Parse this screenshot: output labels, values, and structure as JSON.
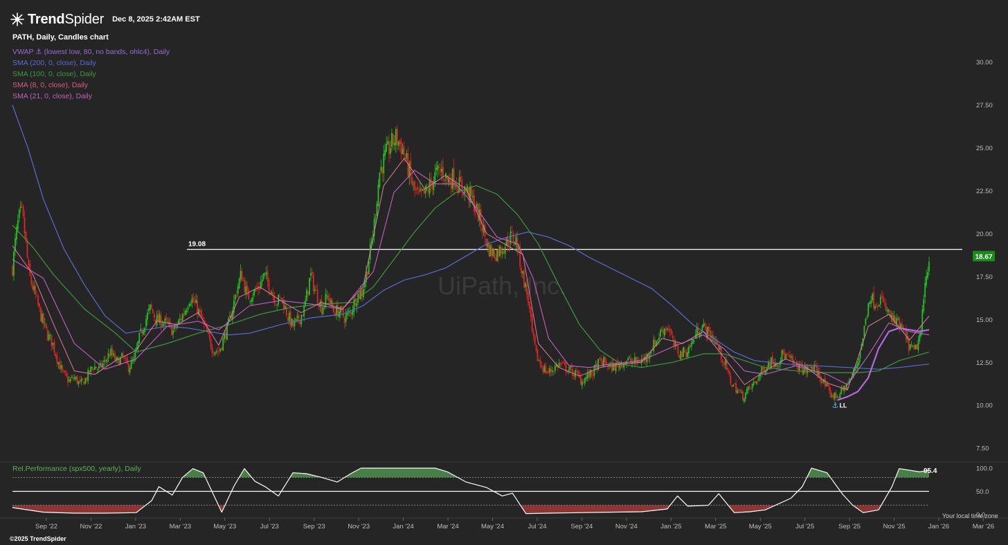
{
  "header": {
    "brand_bold": "Trend",
    "brand_thin": "Spider",
    "datetime": "Dec 8, 2025 2:42AM EST"
  },
  "symbol_line": "PATH, Daily, Candles chart",
  "indicators": [
    {
      "label": "VWAP ⚓ (lowest low, 80, no bands, ohlc4), Daily",
      "color": "#9b6bd4"
    },
    {
      "label": "SMA (200, 0, close), Daily",
      "color": "#5c6bd0"
    },
    {
      "label": "SMA (100, 0, close), Daily",
      "color": "#3d9a3d"
    },
    {
      "label": "SMA (8, 0, close), Daily",
      "color": "#e05a86"
    },
    {
      "label": "SMA (21, 0, close), Daily",
      "color": "#c75fc4"
    }
  ],
  "watermark": "UiPath, Inc.",
  "rel_perf": {
    "label": "Rel.Performance (spx500, yearly), Daily",
    "y_ticks": [
      "100.0",
      "50.0",
      "0.0"
    ],
    "last_value": "95.4"
  },
  "footer": {
    "copyright": "©2025 TrendSpider",
    "timezone": "Your local time zone"
  },
  "anchor_label": "LL",
  "chart_data": {
    "type": "candlestick",
    "symbol": "PATH",
    "interval": "Daily",
    "y_ticks": [
      7.5,
      10,
      12.5,
      15,
      17.5,
      20,
      22.5,
      25,
      27.5,
      30
    ],
    "y_tick_labels": [
      "7.50",
      "10.00",
      "12.50",
      "15.00",
      "17.50",
      "20.00",
      "22.50",
      "25.00",
      "27.50",
      "30.00"
    ],
    "ylim": [
      6.9,
      31.2
    ],
    "x_ticks": [
      "Sep '22",
      "Nov '22",
      "Jan '23",
      "Mar '23",
      "May '23",
      "Jul '23",
      "Sep '23",
      "Nov '23",
      "Jan '24",
      "Mar '24",
      "May '24",
      "Jul '24",
      "Sep '24",
      "Nov '24",
      "Jan '25",
      "Mar '25",
      "May '25",
      "Jul '25",
      "Sep '25",
      "Nov '25",
      "Jan '26",
      "Mar '26"
    ],
    "horizontal_line": {
      "value": 19.08,
      "label": "19.08"
    },
    "last_price": {
      "value": 18.67,
      "label": "18.67",
      "color": "#1a8c1a"
    },
    "price_path": [
      [
        0,
        18.0
      ],
      [
        0.3,
        19.7
      ],
      [
        0.6,
        20.9
      ],
      [
        0.9,
        21.3
      ],
      [
        1.2,
        20.0
      ],
      [
        1.6,
        17.6
      ],
      [
        2.2,
        16.4
      ],
      [
        2.8,
        15.1
      ],
      [
        3.4,
        14.1
      ],
      [
        3.9,
        13.6
      ],
      [
        4.4,
        12.6
      ],
      [
        4.9,
        11.8
      ],
      [
        5.5,
        11.4
      ],
      [
        6.0,
        11.6
      ],
      [
        6.6,
        11.2
      ],
      [
        7.2,
        11.6
      ],
      [
        7.8,
        12.3
      ],
      [
        8.4,
        12.1
      ],
      [
        8.9,
        12.5
      ],
      [
        9.5,
        13.1
      ],
      [
        10.1,
        12.5
      ],
      [
        10.7,
        12.8
      ],
      [
        11.2,
        12.2
      ],
      [
        11.8,
        12.6
      ],
      [
        12.3,
        13.9
      ],
      [
        12.8,
        14.8
      ],
      [
        13.4,
        15.7
      ],
      [
        13.9,
        15.0
      ],
      [
        14.5,
        14.9
      ],
      [
        15.0,
        14.7
      ],
      [
        15.6,
        14.3
      ],
      [
        16.1,
        14.8
      ],
      [
        16.7,
        15.5
      ],
      [
        17.2,
        16.3
      ],
      [
        17.8,
        15.8
      ],
      [
        18.3,
        15.1
      ],
      [
        18.9,
        14.1
      ],
      [
        19.4,
        13.3
      ],
      [
        20.0,
        13.1
      ],
      [
        20.5,
        13.9
      ],
      [
        21.1,
        15.0
      ],
      [
        21.7,
        16.6
      ],
      [
        22.2,
        17.7
      ],
      [
        22.8,
        16.3
      ],
      [
        23.3,
        16.5
      ],
      [
        23.9,
        16.9
      ],
      [
        24.4,
        17.6
      ],
      [
        25.0,
        16.9
      ],
      [
        25.6,
        16.0
      ],
      [
        26.1,
        16.3
      ],
      [
        26.7,
        15.2
      ],
      [
        27.2,
        14.6
      ],
      [
        27.8,
        15.0
      ],
      [
        28.3,
        15.6
      ],
      [
        28.9,
        17.6
      ],
      [
        29.4,
        16.6
      ],
      [
        30.0,
        15.7
      ],
      [
        30.6,
        16.4
      ],
      [
        31.1,
        15.5
      ],
      [
        31.7,
        15.5
      ],
      [
        32.2,
        15.1
      ],
      [
        32.8,
        15.4
      ],
      [
        33.3,
        16.3
      ],
      [
        33.9,
        16.6
      ],
      [
        34.4,
        17.9
      ],
      [
        35.0,
        20.1
      ],
      [
        35.6,
        23.6
      ],
      [
        36.1,
        24.4
      ],
      [
        36.7,
        25.2
      ],
      [
        37.2,
        25.6
      ],
      [
        37.8,
        25.0
      ],
      [
        38.3,
        24.0
      ],
      [
        38.9,
        22.6
      ],
      [
        39.4,
        22.1
      ],
      [
        40.0,
        22.3
      ],
      [
        40.6,
        22.9
      ],
      [
        41.1,
        23.5
      ],
      [
        41.7,
        23.7
      ],
      [
        42.2,
        23.1
      ],
      [
        42.8,
        23.3
      ],
      [
        43.3,
        22.8
      ],
      [
        43.9,
        22.6
      ],
      [
        44.4,
        22.2
      ],
      [
        45.0,
        21.4
      ],
      [
        45.6,
        20.4
      ],
      [
        46.1,
        19.2
      ],
      [
        46.7,
        18.8
      ],
      [
        47.2,
        19.0
      ],
      [
        47.8,
        19.4
      ],
      [
        48.3,
        19.8
      ],
      [
        48.9,
        19.6
      ],
      [
        49.4,
        17.8
      ],
      [
        50.0,
        16.2
      ],
      [
        50.4,
        14.2
      ],
      [
        50.8,
        12.9
      ],
      [
        51.3,
        12.3
      ],
      [
        51.9,
        11.9
      ],
      [
        52.4,
        12.1
      ],
      [
        53.0,
        12.4
      ],
      [
        53.6,
        12.2
      ],
      [
        54.1,
        12.0
      ],
      [
        54.7,
        11.8
      ],
      [
        55.2,
        11.4
      ],
      [
        55.8,
        11.7
      ],
      [
        56.3,
        11.9
      ],
      [
        56.9,
        12.5
      ],
      [
        57.5,
        12.5
      ],
      [
        58.0,
        12.2
      ],
      [
        58.6,
        12.3
      ],
      [
        59.1,
        12.5
      ],
      [
        59.7,
        12.6
      ],
      [
        60.2,
        12.5
      ],
      [
        60.8,
        12.6
      ],
      [
        61.4,
        12.7
      ],
      [
        61.9,
        13.3
      ],
      [
        62.5,
        13.8
      ],
      [
        63.0,
        14.4
      ],
      [
        63.6,
        14.6
      ],
      [
        64.1,
        13.5
      ],
      [
        64.7,
        13.0
      ],
      [
        65.3,
        13.1
      ],
      [
        65.8,
        13.5
      ],
      [
        66.4,
        14.3
      ],
      [
        66.9,
        14.6
      ],
      [
        67.5,
        14.2
      ],
      [
        68.1,
        13.9
      ],
      [
        68.6,
        13.1
      ],
      [
        69.2,
        12.2
      ],
      [
        69.7,
        11.3
      ],
      [
        70.3,
        10.9
      ],
      [
        70.8,
        10.5
      ],
      [
        71.4,
        10.9
      ],
      [
        72.0,
        11.3
      ],
      [
        72.5,
        11.8
      ],
      [
        73.1,
        12.3
      ],
      [
        73.6,
        12.6
      ],
      [
        74.2,
        12.5
      ],
      [
        74.7,
        13.0
      ],
      [
        75.3,
        12.7
      ],
      [
        75.9,
        12.4
      ],
      [
        76.4,
        12.2
      ],
      [
        77.0,
        12.0
      ],
      [
        77.5,
        12.3
      ],
      [
        78.1,
        11.9
      ],
      [
        78.6,
        11.4
      ],
      [
        79.2,
        10.7
      ],
      [
        79.8,
        10.5
      ],
      [
        80.3,
        10.7
      ],
      [
        80.9,
        11.2
      ],
      [
        81.4,
        11.6
      ],
      [
        82.0,
        12.6
      ],
      [
        82.5,
        14.0
      ],
      [
        83.1,
        16.4
      ],
      [
        83.6,
        16.0
      ],
      [
        84.2,
        16.2
      ],
      [
        84.7,
        15.6
      ],
      [
        85.3,
        15.0
      ],
      [
        85.9,
        14.7
      ],
      [
        86.4,
        14.3
      ],
      [
        87.0,
        13.4
      ],
      [
        87.5,
        13.1
      ],
      [
        88.1,
        14.2
      ],
      [
        88.5,
        17.0
      ],
      [
        88.9,
        18.67
      ]
    ],
    "sma8_path": [
      [
        0,
        19.3
      ],
      [
        2,
        17.6
      ],
      [
        4,
        14.7
      ],
      [
        6,
        12.0
      ],
      [
        8,
        11.8
      ],
      [
        10,
        12.6
      ],
      [
        12,
        13.2
      ],
      [
        14,
        14.9
      ],
      [
        16,
        14.7
      ],
      [
        18,
        15.4
      ],
      [
        20,
        13.5
      ],
      [
        22,
        16.3
      ],
      [
        24,
        16.9
      ],
      [
        26,
        16.1
      ],
      [
        28,
        15.4
      ],
      [
        30,
        16.0
      ],
      [
        32,
        15.6
      ],
      [
        34,
        16.9
      ],
      [
        36,
        22.8
      ],
      [
        38,
        24.4
      ],
      [
        40,
        22.6
      ],
      [
        42,
        23.4
      ],
      [
        44,
        22.6
      ],
      [
        46,
        20.0
      ],
      [
        48,
        19.3
      ],
      [
        49.5,
        18.8
      ],
      [
        51,
        13.6
      ],
      [
        53,
        12.2
      ],
      [
        55,
        11.7
      ],
      [
        57,
        12.2
      ],
      [
        59,
        12.4
      ],
      [
        61,
        12.5
      ],
      [
        63,
        13.9
      ],
      [
        65,
        13.6
      ],
      [
        67,
        14.3
      ],
      [
        69,
        12.8
      ],
      [
        71,
        11.2
      ],
      [
        73,
        12.0
      ],
      [
        75,
        12.7
      ],
      [
        77,
        12.2
      ],
      [
        79,
        11.3
      ],
      [
        81,
        10.9
      ],
      [
        83,
        14.6
      ],
      [
        85,
        15.3
      ],
      [
        87,
        13.8
      ],
      [
        88.9,
        15.2
      ]
    ],
    "sma21_path": [
      [
        0,
        18.5
      ],
      [
        3,
        17.4
      ],
      [
        6,
        13.6
      ],
      [
        9,
        12.1
      ],
      [
        12,
        12.7
      ],
      [
        15,
        14.6
      ],
      [
        18,
        14.9
      ],
      [
        20,
        14.4
      ],
      [
        23,
        15.8
      ],
      [
        26,
        16.1
      ],
      [
        29,
        15.9
      ],
      [
        32,
        15.6
      ],
      [
        35,
        17.8
      ],
      [
        37,
        22.4
      ],
      [
        39,
        23.7
      ],
      [
        41,
        22.9
      ],
      [
        43,
        22.9
      ],
      [
        45,
        21.5
      ],
      [
        47,
        19.8
      ],
      [
        49,
        19.4
      ],
      [
        50.5,
        17.4
      ],
      [
        52,
        13.9
      ],
      [
        54,
        12.3
      ],
      [
        56,
        12.2
      ],
      [
        58,
        12.4
      ],
      [
        61,
        12.6
      ],
      [
        64,
        13.4
      ],
      [
        67,
        14.1
      ],
      [
        69,
        13.3
      ],
      [
        71,
        12.0
      ],
      [
        73,
        11.8
      ],
      [
        76,
        12.3
      ],
      [
        79,
        11.8
      ],
      [
        81,
        11.2
      ],
      [
        83,
        12.9
      ],
      [
        85,
        14.8
      ],
      [
        87,
        14.3
      ],
      [
        88.9,
        14.1
      ]
    ],
    "sma100_path": [
      [
        0,
        20.5
      ],
      [
        2,
        19.2
      ],
      [
        4,
        17.6
      ],
      [
        7,
        15.6
      ],
      [
        10,
        14.2
      ],
      [
        12,
        13.1
      ],
      [
        15,
        13.6
      ],
      [
        18,
        14.2
      ],
      [
        21,
        14.7
      ],
      [
        24,
        15.3
      ],
      [
        27,
        15.7
      ],
      [
        30,
        15.9
      ],
      [
        33,
        16.0
      ],
      [
        35,
        16.9
      ],
      [
        37,
        18.5
      ],
      [
        39,
        20.1
      ],
      [
        41,
        21.5
      ],
      [
        43,
        22.4
      ],
      [
        45,
        22.8
      ],
      [
        47,
        22.3
      ],
      [
        49,
        21.1
      ],
      [
        51,
        19.4
      ],
      [
        53,
        17.0
      ],
      [
        55,
        14.7
      ],
      [
        57,
        13.2
      ],
      [
        59,
        12.4
      ],
      [
        61,
        12.2
      ],
      [
        64,
        12.5
      ],
      [
        67,
        13.0
      ],
      [
        69,
        13.0
      ],
      [
        71,
        12.6
      ],
      [
        73,
        12.2
      ],
      [
        76,
        12.0
      ],
      [
        79,
        11.9
      ],
      [
        82,
        11.9
      ],
      [
        84,
        12.0
      ],
      [
        86,
        12.6
      ],
      [
        88.9,
        13.1
      ]
    ],
    "sma200_path": [
      [
        0,
        27.5
      ],
      [
        1.5,
        25.0
      ],
      [
        3,
        22.0
      ],
      [
        5,
        19.1
      ],
      [
        7,
        17.0
      ],
      [
        9,
        15.2
      ],
      [
        11,
        14.2
      ],
      [
        13,
        14.4
      ],
      [
        15,
        14.6
      ],
      [
        17,
        14.5
      ],
      [
        19,
        14.3
      ],
      [
        21,
        14.1
      ],
      [
        23,
        14.2
      ],
      [
        26,
        14.7
      ],
      [
        29,
        15.1
      ],
      [
        32,
        15.3
      ],
      [
        34,
        15.8
      ],
      [
        36,
        16.7
      ],
      [
        38,
        17.3
      ],
      [
        40,
        17.6
      ],
      [
        42,
        18.0
      ],
      [
        44,
        18.7
      ],
      [
        46,
        19.4
      ],
      [
        48,
        19.8
      ],
      [
        50,
        20.1
      ],
      [
        52,
        19.8
      ],
      [
        54,
        19.3
      ],
      [
        56,
        18.6
      ],
      [
        58,
        18.0
      ],
      [
        60,
        17.4
      ],
      [
        62,
        16.8
      ],
      [
        64,
        15.8
      ],
      [
        66,
        14.7
      ],
      [
        68,
        13.9
      ],
      [
        70,
        13.1
      ],
      [
        72,
        12.6
      ],
      [
        75,
        12.4
      ],
      [
        78,
        12.3
      ],
      [
        81,
        12.2
      ],
      [
        84,
        12.1
      ],
      [
        86,
        12.2
      ],
      [
        88.9,
        12.4
      ]
    ],
    "vwap_path": [
      [
        80,
        10.3
      ],
      [
        81,
        10.5
      ],
      [
        82,
        10.8
      ],
      [
        83,
        11.6
      ],
      [
        84,
        13.3
      ],
      [
        85,
        14.3
      ],
      [
        86,
        14.5
      ],
      [
        87,
        14.4
      ],
      [
        88,
        14.3
      ],
      [
        88.9,
        14.4
      ]
    ],
    "rel_perf_path": [
      [
        0,
        15
      ],
      [
        3,
        5
      ],
      [
        6,
        3
      ],
      [
        9,
        3
      ],
      [
        12,
        4
      ],
      [
        13.5,
        30
      ],
      [
        14.2,
        60
      ],
      [
        15.5,
        42
      ],
      [
        16.5,
        80
      ],
      [
        17.5,
        99
      ],
      [
        18.5,
        90
      ],
      [
        20.3,
        5
      ],
      [
        21.5,
        62
      ],
      [
        22.5,
        99
      ],
      [
        23.5,
        72
      ],
      [
        24.5,
        60
      ],
      [
        25.8,
        40
      ],
      [
        27.2,
        90
      ],
      [
        28.5,
        88
      ],
      [
        30,
        80
      ],
      [
        31.5,
        70
      ],
      [
        32.8,
        88
      ],
      [
        33.8,
        100
      ],
      [
        36,
        100
      ],
      [
        39,
        100
      ],
      [
        41,
        100
      ],
      [
        42.2,
        92
      ],
      [
        44,
        70
      ],
      [
        46,
        58
      ],
      [
        47.5,
        40
      ],
      [
        48.5,
        46
      ],
      [
        49.8,
        2
      ],
      [
        52,
        3
      ],
      [
        55,
        4
      ],
      [
        58,
        5
      ],
      [
        61,
        6
      ],
      [
        63.5,
        12
      ],
      [
        64.5,
        40
      ],
      [
        65.5,
        18
      ],
      [
        67.5,
        20
      ],
      [
        68.5,
        45
      ],
      [
        70,
        4
      ],
      [
        71.5,
        6
      ],
      [
        73,
        10
      ],
      [
        75.5,
        35
      ],
      [
        76.6,
        60
      ],
      [
        77.5,
        100
      ],
      [
        79,
        90
      ],
      [
        80.5,
        44
      ],
      [
        81.5,
        20
      ],
      [
        82.5,
        4
      ],
      [
        84,
        10
      ],
      [
        85.3,
        60
      ],
      [
        86,
        99
      ],
      [
        88,
        92
      ],
      [
        88.9,
        95.4
      ]
    ]
  }
}
